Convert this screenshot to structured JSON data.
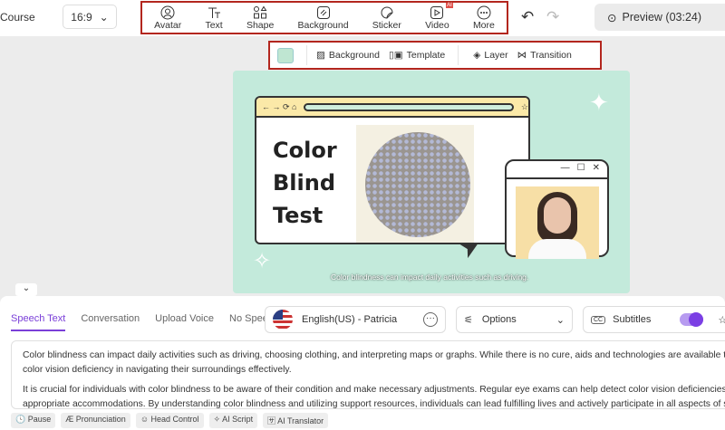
{
  "header": {
    "project": "Course",
    "ratio": "16:9",
    "preview": "Preview (03:24)"
  },
  "tools": [
    {
      "label": "Avatar",
      "icon": "avatar-icon"
    },
    {
      "label": "Text",
      "icon": "text-icon"
    },
    {
      "label": "Shape",
      "icon": "shape-icon"
    },
    {
      "label": "Background",
      "icon": "background-icon"
    },
    {
      "label": "Sticker",
      "icon": "sticker-icon"
    },
    {
      "label": "Video",
      "icon": "video-icon",
      "badge": "AI"
    },
    {
      "label": "More",
      "icon": "more-icon"
    }
  ],
  "subtoolbar": {
    "swatch_color": "#bfe6d2",
    "background": "Background",
    "template": "Template",
    "layer": "Layer",
    "transition": "Transition"
  },
  "slide": {
    "title_lines": [
      "Color",
      "Blind",
      "Test"
    ],
    "caption": "Color blindness can impact daily activities such as driving."
  },
  "panel": {
    "tabs": [
      "Speech Text",
      "Conversation",
      "Upload Voice",
      "No Speech"
    ],
    "voice": "English(US) - Patricia",
    "options": "Options",
    "subtitles": "Subtitles",
    "subtitles_on": true,
    "paragraphs": [
      "Color blindness can impact daily activities such as driving, choosing clothing, and interpreting maps or graphs. While there is no cure, aids and technologies are available to assist individuals with",
      "color vision deficiency in navigating their surroundings effectively.",
      "It is crucial for individuals with color blindness to be aware of their condition and make necessary adjustments. Regular eye exams can help detect color vision deficiencies early, allowing for",
      "appropriate accommodations. By understanding color blindness and utilizing support resources, individuals can lead fulfilling lives and actively participate in all aspects of society."
    ],
    "chips": [
      "Pause",
      "Pronunciation",
      "Head Control",
      "AI Script",
      "AI Translator"
    ]
  },
  "colors": {
    "accent": "#7a3fd8",
    "highlight": "#b3261e"
  }
}
